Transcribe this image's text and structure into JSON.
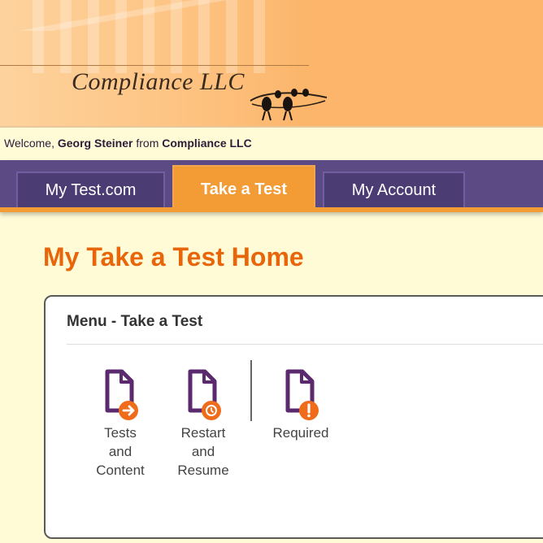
{
  "header": {
    "logo_text": "Compliance LLC"
  },
  "welcome": {
    "prefix": "Welcome,",
    "user": "Georg Steiner",
    "from": "from",
    "company": "Compliance LLC"
  },
  "nav": {
    "tabs": [
      {
        "label": "My Test.com",
        "active": false
      },
      {
        "label": "Take a Test",
        "active": true
      },
      {
        "label": "My Account",
        "active": false
      }
    ]
  },
  "page": {
    "title": "My Take a Test Home"
  },
  "menu": {
    "title": "Menu - Take a Test",
    "items": [
      {
        "label_lines": [
          "Tests",
          "and",
          "Content"
        ],
        "icon": "document-arrow-icon"
      },
      {
        "label_lines": [
          "Restart",
          "and",
          "Resume"
        ],
        "icon": "document-clock-icon"
      },
      {
        "label_lines": [
          "Required"
        ],
        "icon": "document-exclamation-icon"
      }
    ]
  },
  "colors": {
    "header_bg": "#fcb56a",
    "nav_bg": "#5b4a83",
    "active_tab": "#f39b35",
    "title": "#e8650a",
    "icon_purple": "#5b2a6e",
    "badge_orange": "#ef6c1a",
    "page_bg": "#fffbd6"
  }
}
